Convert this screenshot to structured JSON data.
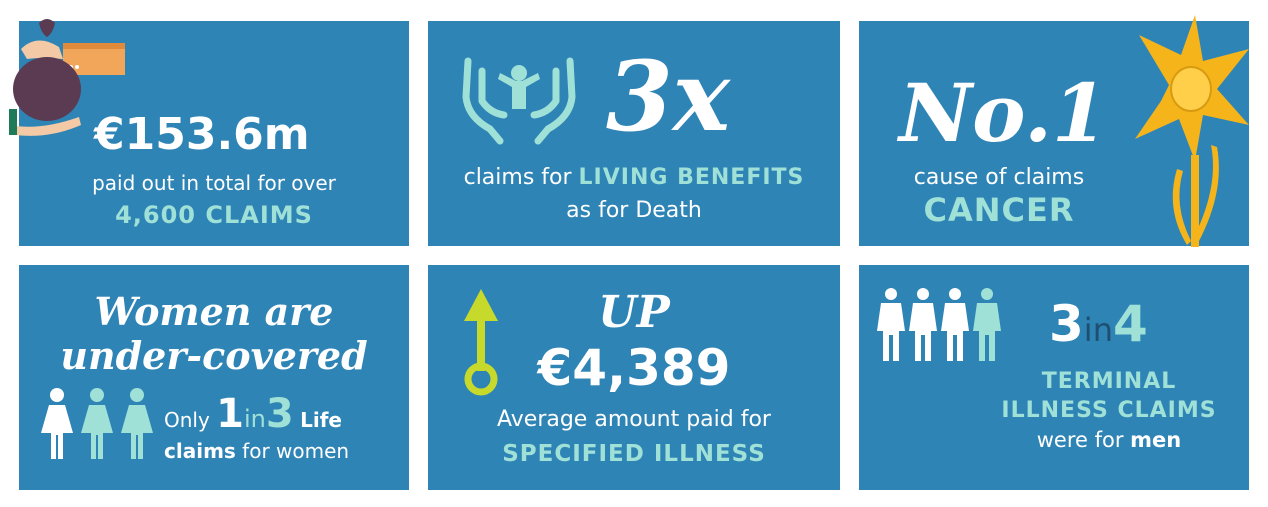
{
  "tile1": {
    "amount": "€153.6m",
    "line1": "paid out in total for over",
    "line2": "4,600 CLAIMS"
  },
  "tile2": {
    "big": "3x",
    "line1_pre": "claims for",
    "line1_em": "LIVING BENEFITS",
    "line2": "as for Death"
  },
  "tile3": {
    "big": "No.1",
    "line1": "cause of claims",
    "line2": "CANCER"
  },
  "tile4": {
    "title1": "Women are",
    "title2": "under-covered",
    "pre": "Only",
    "n1": "1",
    "mid": "in",
    "n2": "3",
    "post": "Life",
    "line2_em": "claims",
    "line2": "for women"
  },
  "tile5": {
    "big": "UP",
    "amount": "€4,389",
    "line1": "Average amount paid for",
    "line2": "SPECIFIED ILLNESS"
  },
  "tile6": {
    "n1": "3",
    "mid": "in",
    "n2": "4",
    "line1": "TERMINAL",
    "line2": "ILLNESS CLAIMS",
    "line3_pre": "were for",
    "line3_em": "men"
  },
  "colors": {
    "tile": "#2f84b6",
    "teal": "#9fe0d7",
    "daffodil": "#f5b41a",
    "arrow": "#c7da2b"
  }
}
